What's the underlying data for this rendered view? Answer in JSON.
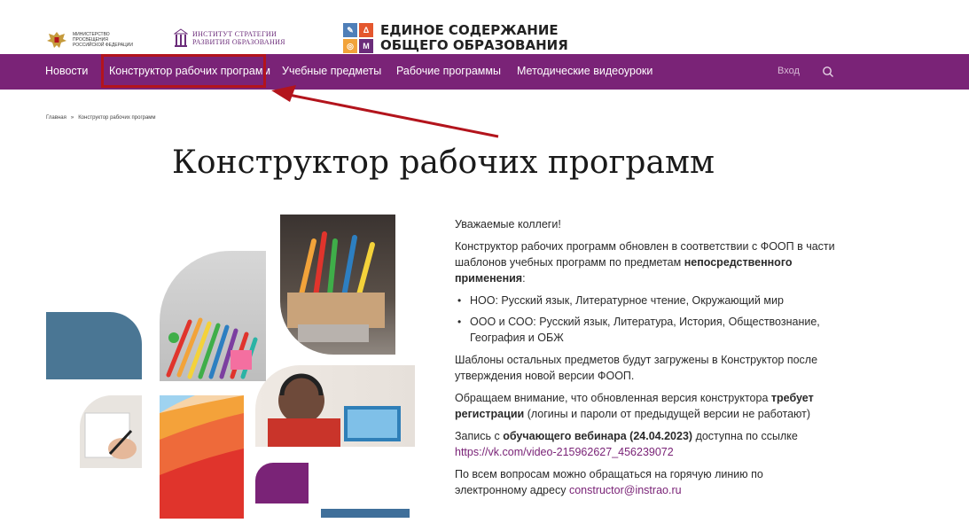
{
  "header": {
    "ministry_text": "Министерство просвещения Российской Федерации",
    "institute_text_line1": "Институт стратегии",
    "institute_text_line2": "развития образования",
    "brand_line1": "ЕДИНОЕ СОДЕРЖАНИЕ",
    "brand_line2": "ОБЩЕГО ОБРАЗОВАНИЯ",
    "brand_tiles": [
      {
        "glyph": "✎",
        "color": "#4f7fb8"
      },
      {
        "glyph": "Δ",
        "color": "#e4572e"
      },
      {
        "glyph": "◎",
        "color": "#f2a33a"
      },
      {
        "glyph": "М",
        "color": "#6b2c7a"
      }
    ]
  },
  "navbar": {
    "items": [
      {
        "label": "Новости"
      },
      {
        "label": "Конструктор рабочих программ"
      },
      {
        "label": "Учебные предметы"
      },
      {
        "label": "Рабочие программы"
      },
      {
        "label": "Методические видеоуроки"
      }
    ],
    "login": "Вход",
    "search_icon": "search-icon",
    "color": "#7a2377"
  },
  "breadcrumb": {
    "home": "Главная",
    "separator": "»",
    "current": "Конструктор рабочих программ"
  },
  "page_title": "Конструктор рабочих программ",
  "content": {
    "greeting": "Уважаемые коллеги!",
    "p1_text": "Конструктор рабочих программ обновлен в соответствии с ФООП в части шаблонов учебных программ по предметам",
    "p1_bold": "непосредственного применения",
    "p1_end": ":",
    "bullets": [
      "НОО: Русский язык, Литературное чтение, Окружающий мир",
      "ООО и СОО: Русский язык, Литература, История, Обществознание, География и ОБЖ"
    ],
    "p2": "Шаблоны остальных предметов будут загружены в Конструктор после утверждения новой версии ФООП.",
    "p3_start": "Обращаем внимание, что обновленная версия конструктора",
    "p3_bold": "требует регистрации",
    "p3_end": "(логины и пароли от предыдущей версии не работают)",
    "p4_start": "Запись с",
    "p4_bold": "обучающего вебинара (24.04.2023)",
    "p4_end": "доступна по ссылке",
    "p4_link": "https://vk.com/video-215962627_456239072",
    "p5_start": "По всем вопросам можно обращаться на горячую линию по электронному адресу",
    "p5_link": "constructor@instrao.ru"
  },
  "colors": {
    "accent": "#7a2377",
    "highlight": "#b3141c"
  }
}
